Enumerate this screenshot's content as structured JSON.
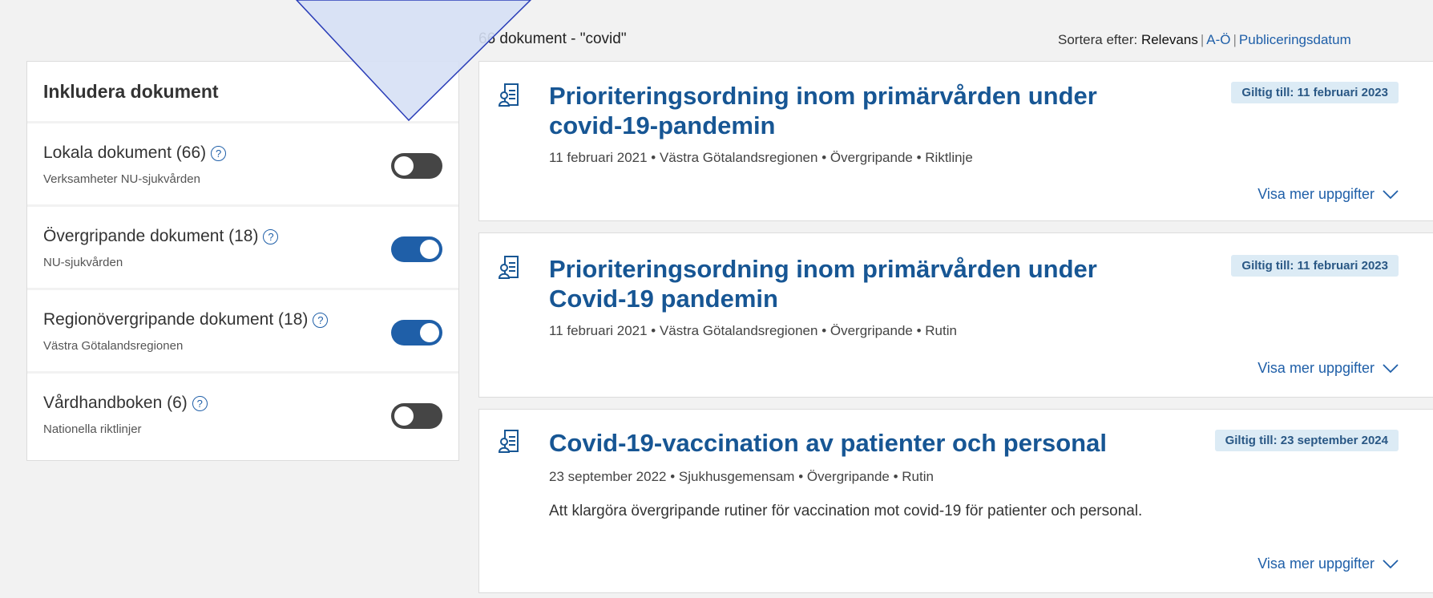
{
  "results": {
    "count_text": "66 dokument - \"covid\""
  },
  "sort": {
    "label": "Sortera efter:",
    "current": "Relevans",
    "options": [
      "A-Ö",
      "Publiceringsdatum"
    ]
  },
  "filter": {
    "heading": "Inkludera dokument",
    "items": [
      {
        "title": "Lokala dokument (66)",
        "subtitle": "Verksamheter NU-sjukvården",
        "enabled": false
      },
      {
        "title": "Övergripande dokument (18)",
        "subtitle": "NU-sjukvården",
        "enabled": true
      },
      {
        "title": "Regionövergripande dokument (18)",
        "subtitle": "Västra Götalandsregionen",
        "enabled": true
      },
      {
        "title": "Vårdhandboken (6)",
        "subtitle": "Nationella riktlinjer",
        "enabled": false
      }
    ],
    "help_glyph": "?"
  },
  "documents": [
    {
      "title": "Prioriteringsordning inom primärvården under covid-19-pandemin",
      "badge": "Giltig till: 11 februari 2023",
      "meta": "11 februari 2021 • Västra Götalandsregionen • Övergripande • Riktlinje",
      "description": "",
      "more_label": "Visa mer uppgifter"
    },
    {
      "title": "Prioriteringsordning inom primärvården under Covid-19 pandemin",
      "badge": "Giltig till: 11 februari 2023",
      "meta": "11 februari 2021 • Västra Götalandsregionen • Övergripande • Rutin",
      "description": "",
      "more_label": "Visa mer uppgifter"
    },
    {
      "title": "Covid-19-vaccination av patienter och personal",
      "badge": "Giltig till: 23 september 2024",
      "meta": "23 september 2022 • Sjukhusgemensam • Övergripande • Rutin",
      "description": "Att klargöra övergripande rutiner för vaccination mot covid-19 för patienter och personal.",
      "more_label": "Visa mer uppgifter"
    }
  ],
  "colors": {
    "accent": "#1f5fa8",
    "title": "#175694",
    "badge_bg": "#dcebf5",
    "toggle_off": "#454545",
    "page_bg": "#f2f2f2"
  }
}
